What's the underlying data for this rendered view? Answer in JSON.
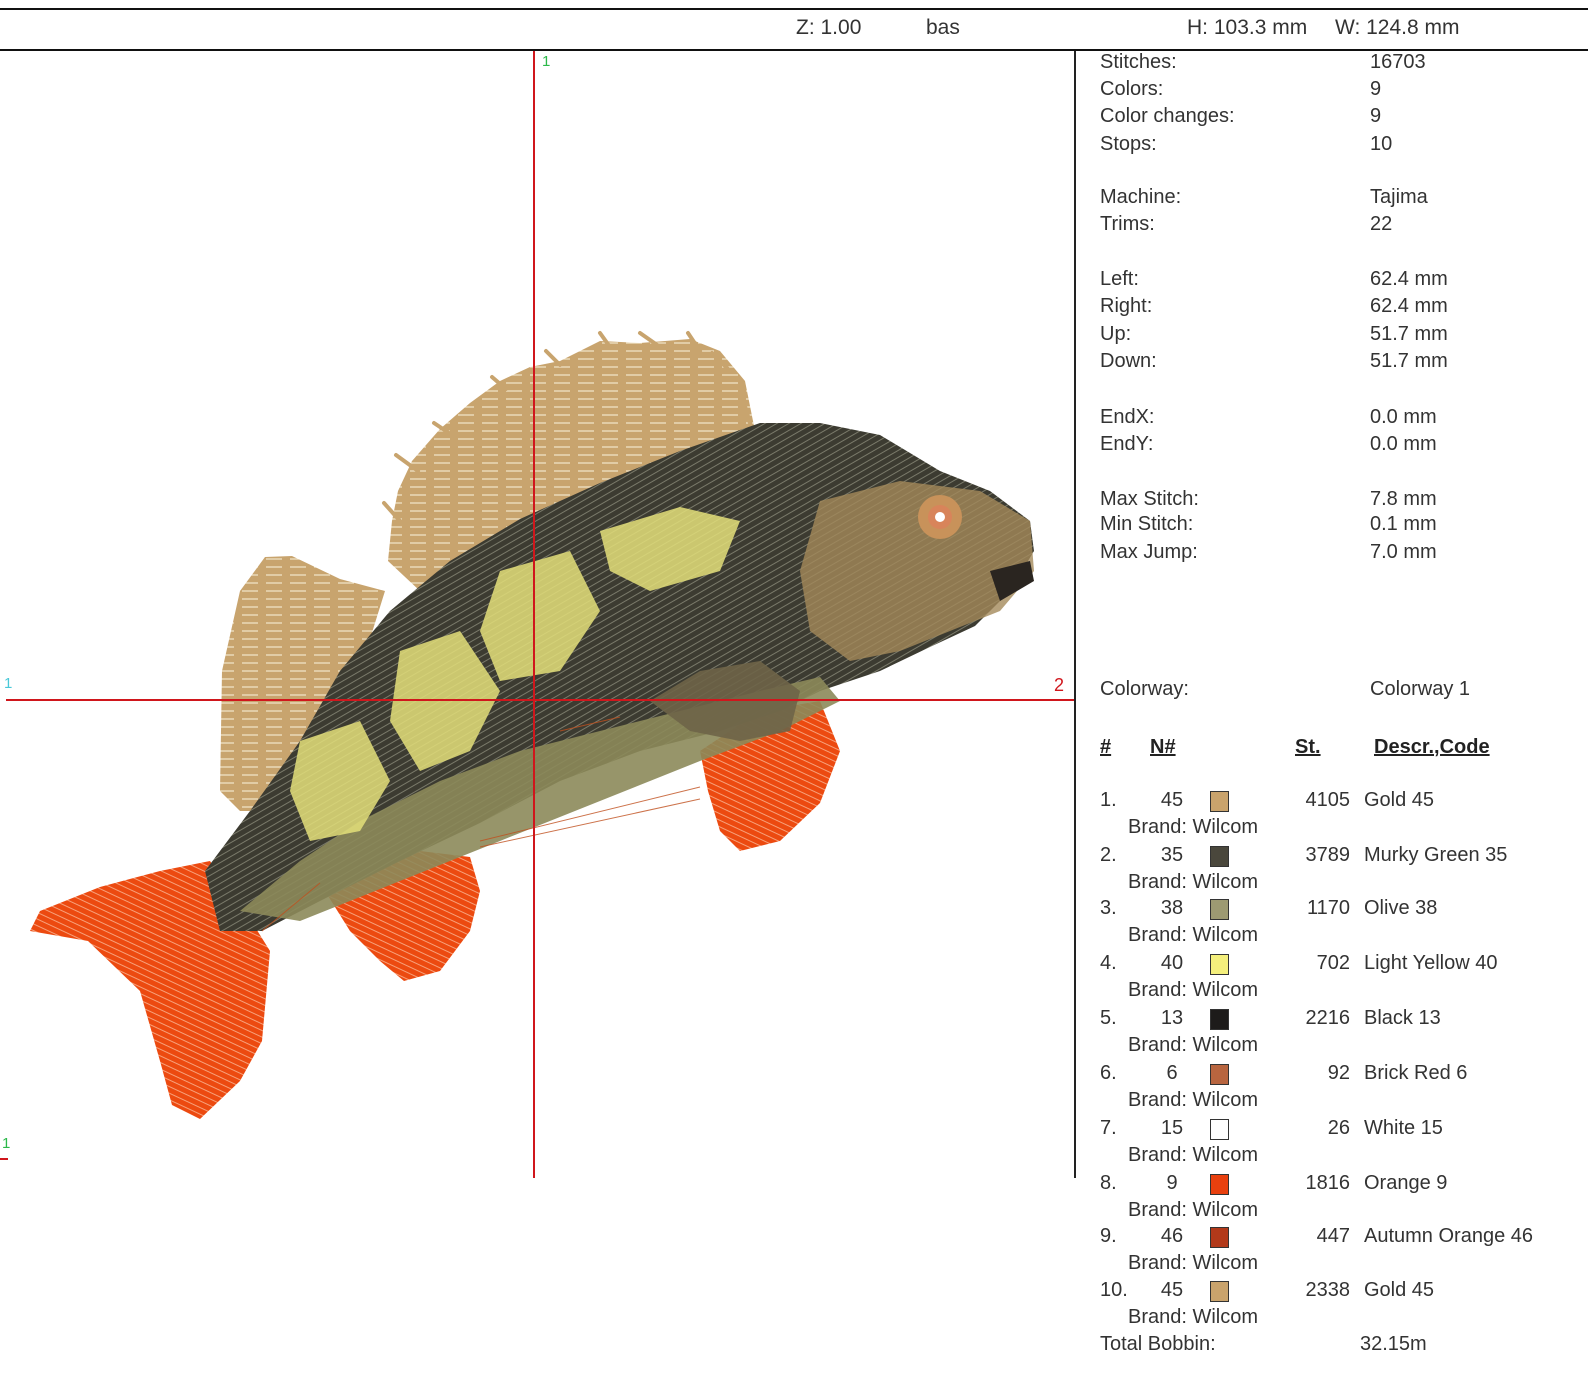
{
  "header": {
    "zoom": "Z: 1.00",
    "mode": "bas",
    "height": "H: 103.3 mm",
    "width": "W: 124.8 mm"
  },
  "canvas": {
    "axis_labels": {
      "top": "1",
      "left": "1",
      "right": "2",
      "bottom_left": "1"
    },
    "colors": {
      "crosshair": "#d0161c",
      "fin": "#c8a46e",
      "body_dark": "#3c3b31",
      "body_olive": "#8c8a5a",
      "stripe_yellow": "#e4e07a",
      "fin_orange": "#ec4a10",
      "eye": "#d8845a"
    },
    "image_description_icon": "embroidered-fish-icon"
  },
  "stats": [
    {
      "label": "Stitches:",
      "value": "16703"
    },
    {
      "label": "Colors:",
      "value": "9"
    },
    {
      "label": "Color changes:",
      "value": "9"
    },
    {
      "label": "Stops:",
      "value": "10"
    },
    {
      "label": "Machine:",
      "value": "Tajima"
    },
    {
      "label": "Trims:",
      "value": "22"
    },
    {
      "label": "Left:",
      "value": "62.4 mm"
    },
    {
      "label": "Right:",
      "value": "62.4 mm"
    },
    {
      "label": "Up:",
      "value": "51.7 mm"
    },
    {
      "label": "Down:",
      "value": "51.7 mm"
    },
    {
      "label": "EndX:",
      "value": "0.0 mm"
    },
    {
      "label": "EndY:",
      "value": "0.0 mm"
    },
    {
      "label": "Max Stitch:",
      "value": "7.8 mm"
    },
    {
      "label": "Min Stitch:",
      "value": "0.1 mm"
    },
    {
      "label": "Max Jump:",
      "value": "7.0 mm"
    },
    {
      "label": "Colorway:",
      "value": "Colorway 1"
    }
  ],
  "table": {
    "headers": {
      "index": "#",
      "needle": "N#",
      "stitches": "St.",
      "description": "Descr.,Code"
    },
    "rows": [
      {
        "index": "1.",
        "needle": "45",
        "swatch": "#c9a36c",
        "stitches": "4105",
        "description": "Gold 45",
        "brand": "Brand: Wilcom"
      },
      {
        "index": "2.",
        "needle": "35",
        "swatch": "#4a473c",
        "stitches": "3789",
        "description": "Murky Green 35",
        "brand": "Brand: Wilcom"
      },
      {
        "index": "3.",
        "needle": "38",
        "swatch": "#9d9a72",
        "stitches": "1170",
        "description": "Olive 38",
        "brand": "Brand: Wilcom"
      },
      {
        "index": "4.",
        "needle": "40",
        "swatch": "#f4ef7c",
        "stitches": "702",
        "description": "Light Yellow 40",
        "brand": "Brand: Wilcom"
      },
      {
        "index": "5.",
        "needle": "13",
        "swatch": "#1d1b1a",
        "stitches": "2216",
        "description": "Black 13",
        "brand": "Brand: Wilcom"
      },
      {
        "index": "6.",
        "needle": "6",
        "swatch": "#b8653f",
        "stitches": "92",
        "description": "Brick Red 6",
        "brand": "Brand: Wilcom"
      },
      {
        "index": "7.",
        "needle": "15",
        "swatch": "#ffffff",
        "stitches": "26",
        "description": "White 15",
        "brand": "Brand: Wilcom"
      },
      {
        "index": "8.",
        "needle": "9",
        "swatch": "#e8400e",
        "stitches": "1816",
        "description": "Orange 9",
        "brand": "Brand: Wilcom"
      },
      {
        "index": "9.",
        "needle": "46",
        "swatch": "#b2391a",
        "stitches": "447",
        "description": "Autumn Orange 46",
        "brand": "Brand: Wilcom"
      },
      {
        "index": "10.",
        "needle": "45",
        "swatch": "#c9a36c",
        "stitches": "2338",
        "description": "Gold 45",
        "brand": "Brand: Wilcom"
      }
    ]
  },
  "bobbin": {
    "label": "Total Bobbin:",
    "value": "32.15m"
  }
}
